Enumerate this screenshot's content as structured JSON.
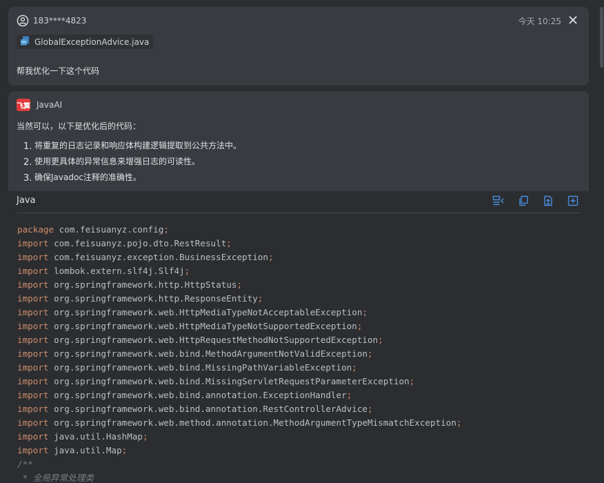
{
  "user_message": {
    "username": "183****4823",
    "time": "今天 10:25",
    "attachment": "GlobalExceptionAdvice.java",
    "text": "帮我优化一下这个代码"
  },
  "ai_reply": {
    "logo_text": "飞算",
    "name": "JavaAI",
    "intro": "当然可以，以下是优化后的代码：",
    "points": [
      {
        "num": "1.",
        "text": "将重复的日志记录和响应体构建逻辑提取到公共方法中。"
      },
      {
        "num": "2.",
        "text": "使用更具体的异常信息来增强日志的可读性。"
      },
      {
        "num": "3.",
        "text": "确保Javadoc注释的准确性。"
      }
    ]
  },
  "code_block": {
    "language": "Java",
    "tools": [
      "insert-diff-icon",
      "copy-icon",
      "insert-file-icon",
      "new-file-icon"
    ],
    "lines": [
      {
        "kw": "package",
        "body": " com.feisuanyz.config",
        "semi": ";"
      },
      {
        "kw": "import",
        "body": " com.feisuanyz.pojo.dto.RestResult",
        "semi": ";"
      },
      {
        "kw": "import",
        "body": " com.feisuanyz.exception.BusinessException",
        "semi": ";"
      },
      {
        "kw": "import",
        "body": " lombok.extern.slf4j.Slf4j",
        "semi": ";"
      },
      {
        "kw": "import",
        "body": " org.springframework.http.HttpStatus",
        "semi": ";"
      },
      {
        "kw": "import",
        "body": " org.springframework.http.ResponseEntity",
        "semi": ";"
      },
      {
        "kw": "import",
        "body": " org.springframework.web.HttpMediaTypeNotAcceptableException",
        "semi": ";"
      },
      {
        "kw": "import",
        "body": " org.springframework.web.HttpMediaTypeNotSupportedException",
        "semi": ";"
      },
      {
        "kw": "import",
        "body": " org.springframework.web.HttpRequestMethodNotSupportedException",
        "semi": ";"
      },
      {
        "kw": "import",
        "body": " org.springframework.web.bind.MethodArgumentNotValidException",
        "semi": ";"
      },
      {
        "kw": "import",
        "body": " org.springframework.web.bind.MissingPathVariableException",
        "semi": ";"
      },
      {
        "kw": "import",
        "body": " org.springframework.web.bind.MissingServletRequestParameterException",
        "semi": ";"
      },
      {
        "kw": "import",
        "body": " org.springframework.web.bind.annotation.ExceptionHandler",
        "semi": ";"
      },
      {
        "kw": "import",
        "body": " org.springframework.web.bind.annotation.RestControllerAdvice",
        "semi": ";"
      },
      {
        "kw": "import",
        "body": " org.springframework.web.method.annotation.MethodArgumentTypeMismatchException",
        "semi": ";"
      },
      {
        "kw": "import",
        "body": " java.util.HashMap",
        "semi": ";"
      },
      {
        "kw": "import",
        "body": " java.util.Map",
        "semi": ";"
      }
    ],
    "comment_lines": [
      "/**",
      " * 全局异常处理类"
    ]
  },
  "colors": {
    "keyword": "#cf8e6d",
    "identifier": "#bcbec4",
    "comment": "#7a7e85",
    "card_bg": "#393b40",
    "code_bg": "#2b2d30",
    "brand_red": "#e03a3a",
    "tool_blue": "#4a8fe0"
  }
}
